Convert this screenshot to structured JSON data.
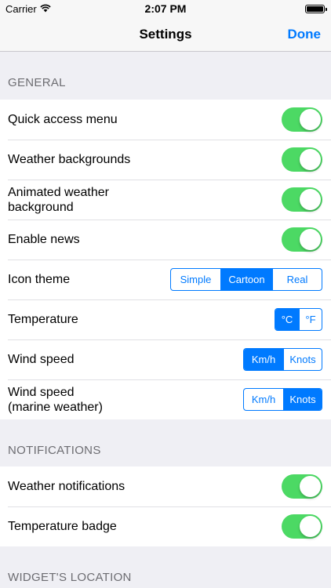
{
  "status_bar": {
    "carrier": "Carrier",
    "time": "2:07 PM",
    "wifi_icon": "wifi-icon",
    "battery_icon": "battery-icon"
  },
  "nav": {
    "title": "Settings",
    "done_label": "Done"
  },
  "colors": {
    "accent": "#007aff",
    "switch_on": "#4cd964",
    "background": "#efeff4"
  },
  "general": {
    "header": "GENERAL",
    "rows": [
      {
        "label": "Quick access menu",
        "on": true
      },
      {
        "label": "Weather backgrounds",
        "on": true
      },
      {
        "label": "Animated weather\nbackground",
        "on": true
      },
      {
        "label": "Enable news",
        "on": true
      }
    ],
    "icon_theme": {
      "label": "Icon theme",
      "options": [
        "Simple",
        "Cartoon",
        "Real"
      ],
      "selected": "Cartoon"
    },
    "temperature": {
      "label": "Temperature",
      "options": [
        "°C",
        "°F"
      ],
      "selected": "°C"
    },
    "wind_speed": {
      "label": "Wind speed",
      "options": [
        "Km/h",
        "Knots"
      ],
      "selected": "Km/h"
    },
    "wind_speed_marine": {
      "label": "Wind speed\n(marine weather)",
      "options": [
        "Km/h",
        "Knots"
      ],
      "selected": "Knots"
    }
  },
  "notifications": {
    "header": "NOTIFICATIONS",
    "rows": [
      {
        "label": "Weather notifications",
        "on": true
      },
      {
        "label": "Temperature badge",
        "on": true
      }
    ]
  },
  "widget_location": {
    "header": "WIDGET'S LOCATION"
  }
}
